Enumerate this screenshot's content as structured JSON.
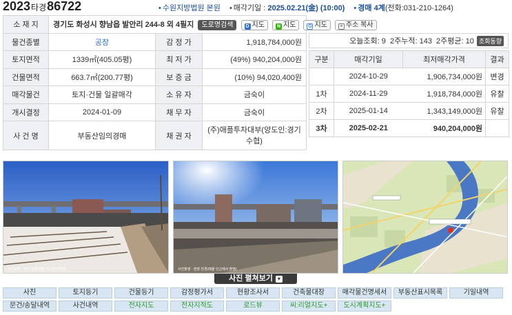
{
  "header": {
    "case_year": "2023",
    "case_kind": "타경",
    "case_number": "86722",
    "court": "수원지방법원 본원",
    "sale_date_label": "매각기일 : ",
    "sale_date_value": "2025.02.21(金) (10:00)",
    "dept_label": "경매 4계",
    "phone": "(전화:031-210-1264)"
  },
  "info": {
    "address_label": "소 재 지",
    "address": "경기도 화성시 향남읍 발안리 244-8 외 4필지",
    "btn_road": "도로명검색",
    "btn_map_d": "지도",
    "btn_map_n": "지도",
    "btn_map_g": "지도",
    "btn_copy": "주소 복사",
    "type_label": "물건종별",
    "type_value": "공장",
    "appraisal_label": "감 정 가",
    "appraisal_value": "1,918,784,000원",
    "land_label": "토지면적",
    "land_value": "1339㎡(405.05평)",
    "min_label": "최 저 가",
    "min_value": "(49%) 940,204,000원",
    "bldg_label": "건물면적",
    "bldg_value": "663.7㎡(200.77평)",
    "deposit_label": "보 증 금",
    "deposit_value": "(10%) 94,020,400원",
    "sale_obj_label": "매각물건",
    "sale_obj_value": "토지·건물 일괄매각",
    "owner_label": "소 유 자",
    "owner_value": "금숙이",
    "start_label": "개시결정",
    "start_value": "2024-01-09",
    "debtor_label": "채 무 자",
    "debtor_value": "금숙이",
    "case_name_label": "사 건 명",
    "case_name_value": "부동산임의경매",
    "creditor_label": "채 권 자",
    "creditor_value": "(주)애플투자대부(양도인:경기수협)"
  },
  "views": {
    "text": "오늘조회: 9  2주누적: 143  2주평균: 10",
    "btn": "조회동향"
  },
  "history": {
    "headers": [
      "구분",
      "매각기일",
      "최저매각가격",
      "결과"
    ],
    "rows": [
      {
        "round": "",
        "date": "2024-10-29",
        "price": "1,906,734,000원",
        "result": "변경"
      },
      {
        "round": "1차",
        "date": "2024-11-29",
        "price": "1,918,784,000원",
        "result": "유찰"
      },
      {
        "round": "2차",
        "date": "2025-01-14",
        "price": "1,343,149,000원",
        "result": "유찰"
      },
      {
        "round": "3차",
        "date": "2025-02-21",
        "price": "940,204,000원",
        "result": ""
      }
    ]
  },
  "photos": {
    "caption": "사진촬영 · 현장 전경(매물 인근에서 촬영)",
    "expand_label": "사진 펼쳐보기"
  },
  "buttons": {
    "row1": [
      "사진",
      "토지등기",
      "건물등기",
      "감정평가서",
      "현황조사서",
      "건축물대장",
      "매각물건명세서",
      "부동산표시목록",
      "기일내역"
    ],
    "row2": [
      "문건/송달내역",
      "사건내역",
      "전자지도",
      "전자지적도",
      "로드뷰",
      "씨:리얼지도+",
      "도시계획지도+"
    ]
  }
}
